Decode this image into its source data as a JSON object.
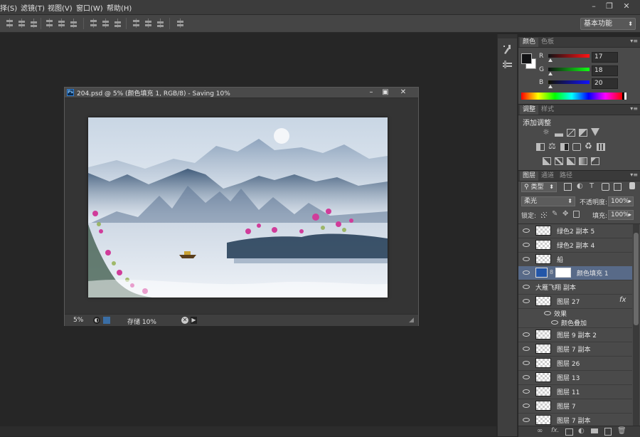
{
  "menu": {
    "items": [
      "择(S)",
      "滤镜(T)",
      "视图(V)",
      "窗口(W)",
      "帮助(H)"
    ]
  },
  "window_controls": {
    "minimize": "–",
    "restore": "❐",
    "close": "✕"
  },
  "options_bar": {
    "workspace": "基本功能"
  },
  "color_panel": {
    "tabs": [
      "颜色",
      "色板"
    ],
    "r_label": "R",
    "g_label": "G",
    "b_label": "B",
    "r": "17",
    "g": "18",
    "b": "20",
    "foreground": "#111214",
    "background": "#ffffff"
  },
  "adjust_panel": {
    "tabs": [
      "调整",
      "样式"
    ],
    "title": "添加调整"
  },
  "layers_panel": {
    "tabs": [
      "图层",
      "通道",
      "路径"
    ],
    "filter_kind": "类型",
    "blend_mode": "柔光",
    "opacity_label": "不透明度:",
    "opacity": "100%",
    "lock_label": "锁定:",
    "fill_label": "填充:",
    "fill": "100%",
    "layers": [
      {
        "name": "绿色2 副本 5"
      },
      {
        "name": "绿色2 副本 4"
      },
      {
        "name": "船"
      },
      {
        "name": "颜色填充 1"
      },
      {
        "name": "大雁飞翔 副本"
      },
      {
        "name": "图层 27",
        "fx": "fx"
      },
      {
        "name": "效果"
      },
      {
        "name": "颜色叠加"
      },
      {
        "name": "图层 9 副本 2"
      },
      {
        "name": "图层 7 副本"
      },
      {
        "name": "图层 26"
      },
      {
        "name": "图层 13"
      },
      {
        "name": "图层 11"
      },
      {
        "name": "图层 7"
      },
      {
        "name": "图层 7 副本"
      }
    ],
    "bottom_icons": [
      "link-icon",
      "fx-icon",
      "mask-icon",
      "adjustment-icon",
      "folder-icon",
      "new-layer-icon",
      "trash-icon"
    ],
    "fx_text": "fx."
  },
  "document": {
    "title": "204.psd @ 5% (颜色填充 1, RGB/8) - Saving 10%",
    "ps_badge": "Ps",
    "zoom": "5%",
    "status": "存储 10%"
  },
  "colors": {
    "accent_selected": "#586a88",
    "color_fill_swatch": "#2356a8"
  }
}
